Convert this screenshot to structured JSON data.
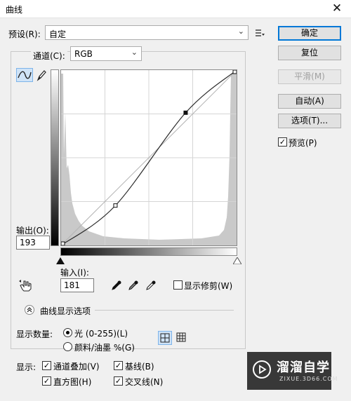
{
  "dialog": {
    "title": "曲线",
    "close_glyph": "✕"
  },
  "preset": {
    "label": "预设(R):",
    "value": "自定",
    "menu_icon": "preset-menu-icon"
  },
  "channel": {
    "label": "通道(C):",
    "value": "RGB"
  },
  "buttons": {
    "ok": "确定",
    "reset": "复位",
    "smooth": "平滑(M)",
    "auto": "自动(A)",
    "options": "选项(T)..."
  },
  "preview": {
    "label": "预览(P)",
    "checked": true
  },
  "output": {
    "label": "输出(O):",
    "value": "193"
  },
  "input": {
    "label": "输入(I):",
    "value": "181"
  },
  "show_clipping": {
    "label": "显示修剪(W)",
    "checked": false
  },
  "display_options": {
    "title": "曲线显示选项"
  },
  "show_amount": {
    "label": "显示数量:",
    "light": "光 (0-255)(L)",
    "pigment": "颜料/油墨 %(G)",
    "selected": "light"
  },
  "show": {
    "label": "显示:",
    "channel_overlays": "通道叠加(V)",
    "baseline": "基线(B)",
    "histogram": "直方图(H)",
    "intersection": "交叉线(N)"
  },
  "watermark": {
    "brand": "溜溜自学",
    "url": "ZIXUE.3D66.COM"
  },
  "curve": {
    "points": [
      [
        0,
        0
      ],
      [
        79,
        58
      ],
      [
        181,
        193
      ],
      [
        255,
        255
      ]
    ]
  }
}
